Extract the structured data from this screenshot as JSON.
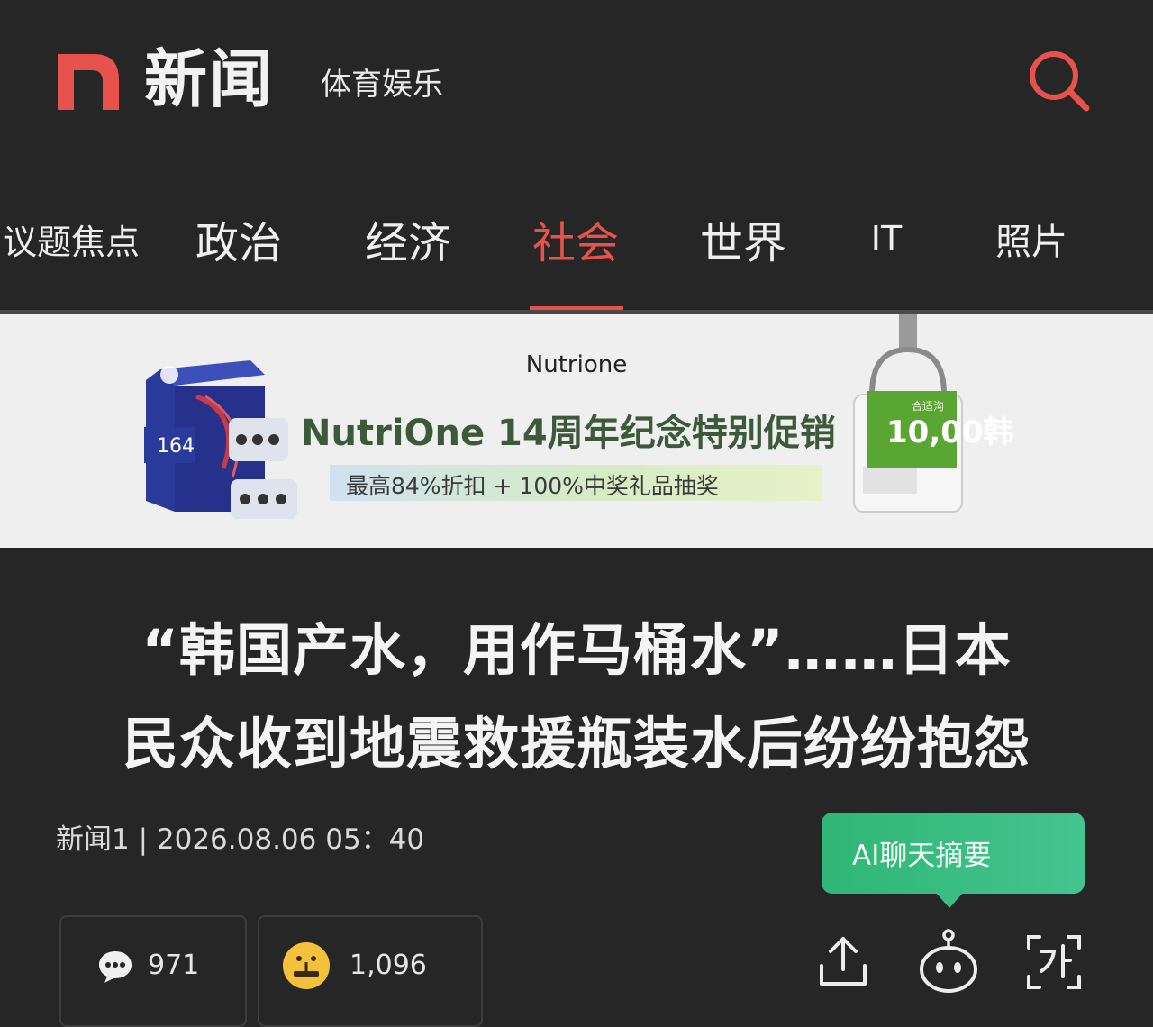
{
  "header": {
    "logo_letter": "n",
    "app_title": "新闻",
    "subtitle": "体育娱乐"
  },
  "tabs": [
    {
      "label": "议题焦点",
      "active": false
    },
    {
      "label": "政治",
      "active": false
    },
    {
      "label": "经济",
      "active": false
    },
    {
      "label": "社会",
      "active": true
    },
    {
      "label": "世界",
      "active": false
    },
    {
      "label": "IT",
      "active": false
    },
    {
      "label": "照片",
      "active": false
    }
  ],
  "ad": {
    "brand": "Nutrione",
    "headline": "NutriOne 14周年纪念特别促销",
    "subline": "最高84%折扣 + 100%中奖礼品抽奖",
    "box_label": "164",
    "price_note": "合适沟",
    "price": "10,00韩"
  },
  "article": {
    "headline_line1": "“韩国产水，用作马桶水”……日本",
    "headline_line2": "民众收到地震救援瓶装水后纷纷抱怨",
    "byline": "新闻1 | 2026.08.06 05：40"
  },
  "ai_summary": {
    "label": "AI聊天摘要"
  },
  "counters": {
    "comments": "971",
    "reactions": "1,096"
  },
  "icons": {
    "search": "search-icon",
    "comment": "comment-bubble-icon",
    "reaction": "reaction-emoji-icon",
    "share": "share-icon",
    "bot": "chatbot-icon",
    "translate": "translate-icon"
  },
  "colors": {
    "background": "#262626",
    "accent_red": "#e8524d",
    "ai_green": "#3cbc84",
    "ad_background": "#efefef"
  }
}
